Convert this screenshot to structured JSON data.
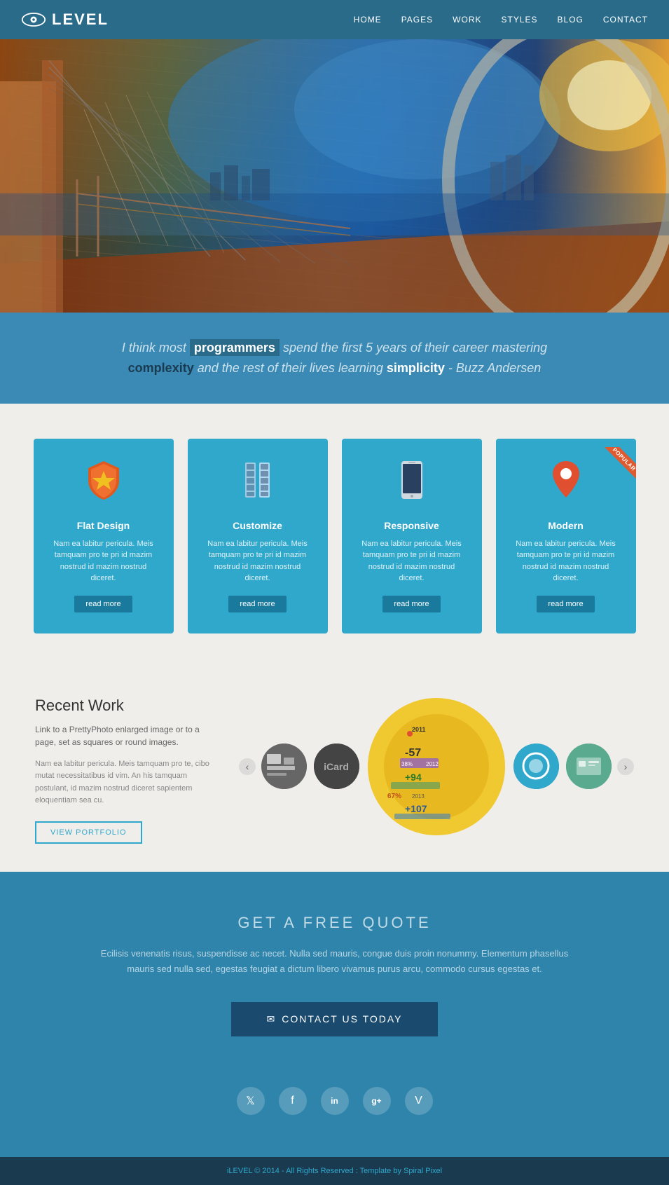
{
  "header": {
    "logo_text": "LEVEL",
    "nav_items": [
      "HOME",
      "PAGES",
      "WORK",
      "STYLES",
      "BLOG",
      "CONTACT"
    ]
  },
  "hero": {
    "alt": "Bridge architecture photo with blue sky and sunset"
  },
  "quote": {
    "pre": "I think most ",
    "highlight": "programmers",
    "mid": " spend the first 5 years of their career mastering ",
    "bold1": "complexity",
    "mid2": "and the rest of their lives learning ",
    "bold2": "simplicity",
    "author": " - Buzz Andersen"
  },
  "features": [
    {
      "id": "flat-design",
      "title": "Flat Design",
      "icon_type": "shield",
      "desc": "Nam ea labitur pericula. Meis tamquam pro te pri id mazim nostrud id mazim nostrud diceret.",
      "btn_label": "read more"
    },
    {
      "id": "customize",
      "title": "Customize",
      "icon_type": "server",
      "desc": "Nam ea labitur pericula. Meis tamquam pro te pri id mazim nostrud id mazim nostrud diceret.",
      "btn_label": "read more"
    },
    {
      "id": "responsive",
      "title": "Responsive",
      "icon_type": "phone",
      "desc": "Nam ea labitur pericula. Meis tamquam pro te pri id mazim nostrud id mazim nostrud diceret.",
      "btn_label": "read more"
    },
    {
      "id": "modern",
      "title": "Modern",
      "icon_type": "pin",
      "desc": "Nam ea labitur pericula. Meis tamquam pro te pri id mazim nostrud id mazim nostrud diceret.",
      "btn_label": "read more",
      "popular": true,
      "popular_label": "POPULAR"
    }
  ],
  "recent_work": {
    "title": "Recent Work",
    "subtitle": "Link to a PrettyPhoto enlarged image or to a page, set as squares or round images.",
    "desc": "Nam ea labitur pericula. Meis tamquam pro te, cibo mutat necessitatibus id vim. An his tamquam postulant, id mazim nostrud diceret sapientem eloquentiam sea cu.",
    "btn_label": "VIEW PORTFOLIO",
    "carousel": {
      "prev_label": "‹",
      "next_label": "›",
      "items": [
        {
          "id": "thumb1",
          "type": "dark-mixed"
        },
        {
          "id": "thumb2",
          "type": "dark-gray"
        },
        {
          "id": "thumb3",
          "type": "infographic"
        },
        {
          "id": "thumb4",
          "type": "teal"
        },
        {
          "id": "thumb5",
          "type": "collage"
        }
      ]
    }
  },
  "cta": {
    "title": "GET A FREE QUOTE",
    "desc": "Ecilisis venenatis risus, suspendisse ac necet. Nulla sed mauris, congue duis proin nonummy. Elementum phasellus mauris sed nulla sed, egestas feugiat a dictum libero vivamus purus arcu, commodo cursus egestas et.",
    "btn_label": "CONTACT US TODAY",
    "social": [
      {
        "name": "twitter",
        "symbol": "𝕏"
      },
      {
        "name": "facebook",
        "symbol": "f"
      },
      {
        "name": "linkedin",
        "symbol": "in"
      },
      {
        "name": "googleplus",
        "symbol": "g+"
      },
      {
        "name": "vimeo",
        "symbol": "V"
      }
    ]
  },
  "footer": {
    "text": "iLEVEL © 2014 - All Rights Reserved : Template by ",
    "brand": "Spiral Pixel"
  }
}
